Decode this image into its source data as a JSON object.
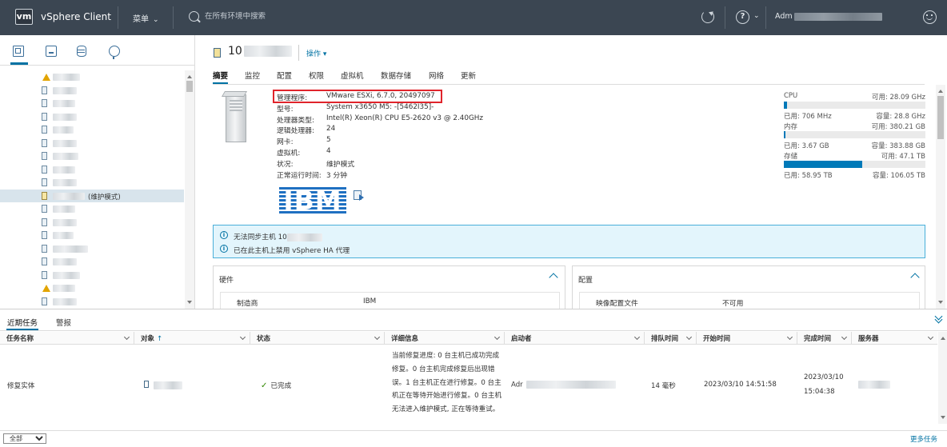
{
  "header": {
    "logo": "vm",
    "app_title": "vSphere Client",
    "menu_label": "菜单",
    "search_placeholder": "在所有环境中搜索",
    "user_prefix": "Adm"
  },
  "navigator": {
    "tab_icons": [
      "hosts-and-clusters-icon",
      "vms-and-templates-icon",
      "storage-icon",
      "networking-icon"
    ],
    "selected_host_suffix": "(维护模式)"
  },
  "host": {
    "name_prefix": "10",
    "actions_label": "操作",
    "tabs": [
      "摘要",
      "监控",
      "配置",
      "权限",
      "虚拟机",
      "数据存储",
      "网络",
      "更新"
    ],
    "active_tab": "摘要",
    "properties": [
      {
        "key": "管理程序:",
        "value": "VMware ESXi, 6.7.0, 20497097"
      },
      {
        "key": "型号:",
        "value": "System x3650 M5: -[5462I35]-"
      },
      {
        "key": "处理器类型:",
        "value": "Intel(R) Xeon(R) CPU E5-2620 v3 @ 2.40GHz"
      },
      {
        "key": "逻辑处理器:",
        "value": "24"
      },
      {
        "key": "网卡:",
        "value": "5"
      },
      {
        "key": "虚拟机:",
        "value": "4"
      },
      {
        "key": "状况:",
        "value": "维护模式"
      },
      {
        "key": "正常运行时间:",
        "value": "3 分钟"
      }
    ],
    "vendor_logo": "IBM"
  },
  "resources": {
    "cpu": {
      "label": "CPU",
      "free": "可用: 28.09 GHz",
      "used": "已用: 706 MHz",
      "capacity": "容量: 28.8 GHz",
      "used_fraction": 0.025
    },
    "memory": {
      "label": "内存",
      "free": "可用: 380.21 GB",
      "used": "已用: 3.67 GB",
      "capacity": "容量: 383.88 GB",
      "used_fraction": 0.01
    },
    "storage": {
      "label": "存储",
      "free": "可用: 47.1 TB",
      "used": "已用: 58.95 TB",
      "capacity": "容量: 106.05 TB",
      "used_fraction": 0.556
    },
    "meter_color": "#0079b8"
  },
  "alerts": {
    "line1": "无法同步主机 10",
    "line2": "已在此主机上禁用 vSphere HA 代理"
  },
  "cards": {
    "hardware": {
      "title": "硬件",
      "row_key": "制造商",
      "row_value": "IBM"
    },
    "config": {
      "title": "配置",
      "row_key": "映像配置文件",
      "row_value": "不可用"
    }
  },
  "tasks": {
    "tabs": [
      "近期任务",
      "警报"
    ],
    "columns": [
      "任务名称",
      "对象",
      "状态",
      "详细信息",
      "启动者",
      "排队时间",
      "开始时间",
      "完成时间",
      "服务器"
    ],
    "sort_indicator": "↑",
    "row": {
      "task_name": "修复实体",
      "status": "已完成",
      "details": "当前修复进度: 0 台主机已成功完成修复。0 台主机完成修复后出现错误。1 台主机正在进行修复。0 台主机正在等待开始进行修复。0 台主机无法进入维护模式, 正在等待重试。",
      "initiator_prefix": "Adr",
      "queued": "14 毫秒",
      "start_time": "2023/03/10 14:51:58",
      "completion_date": "2023/03/10",
      "completion_time": "15:04:38"
    },
    "filter_value": "全部",
    "more_link": "更多任务"
  }
}
